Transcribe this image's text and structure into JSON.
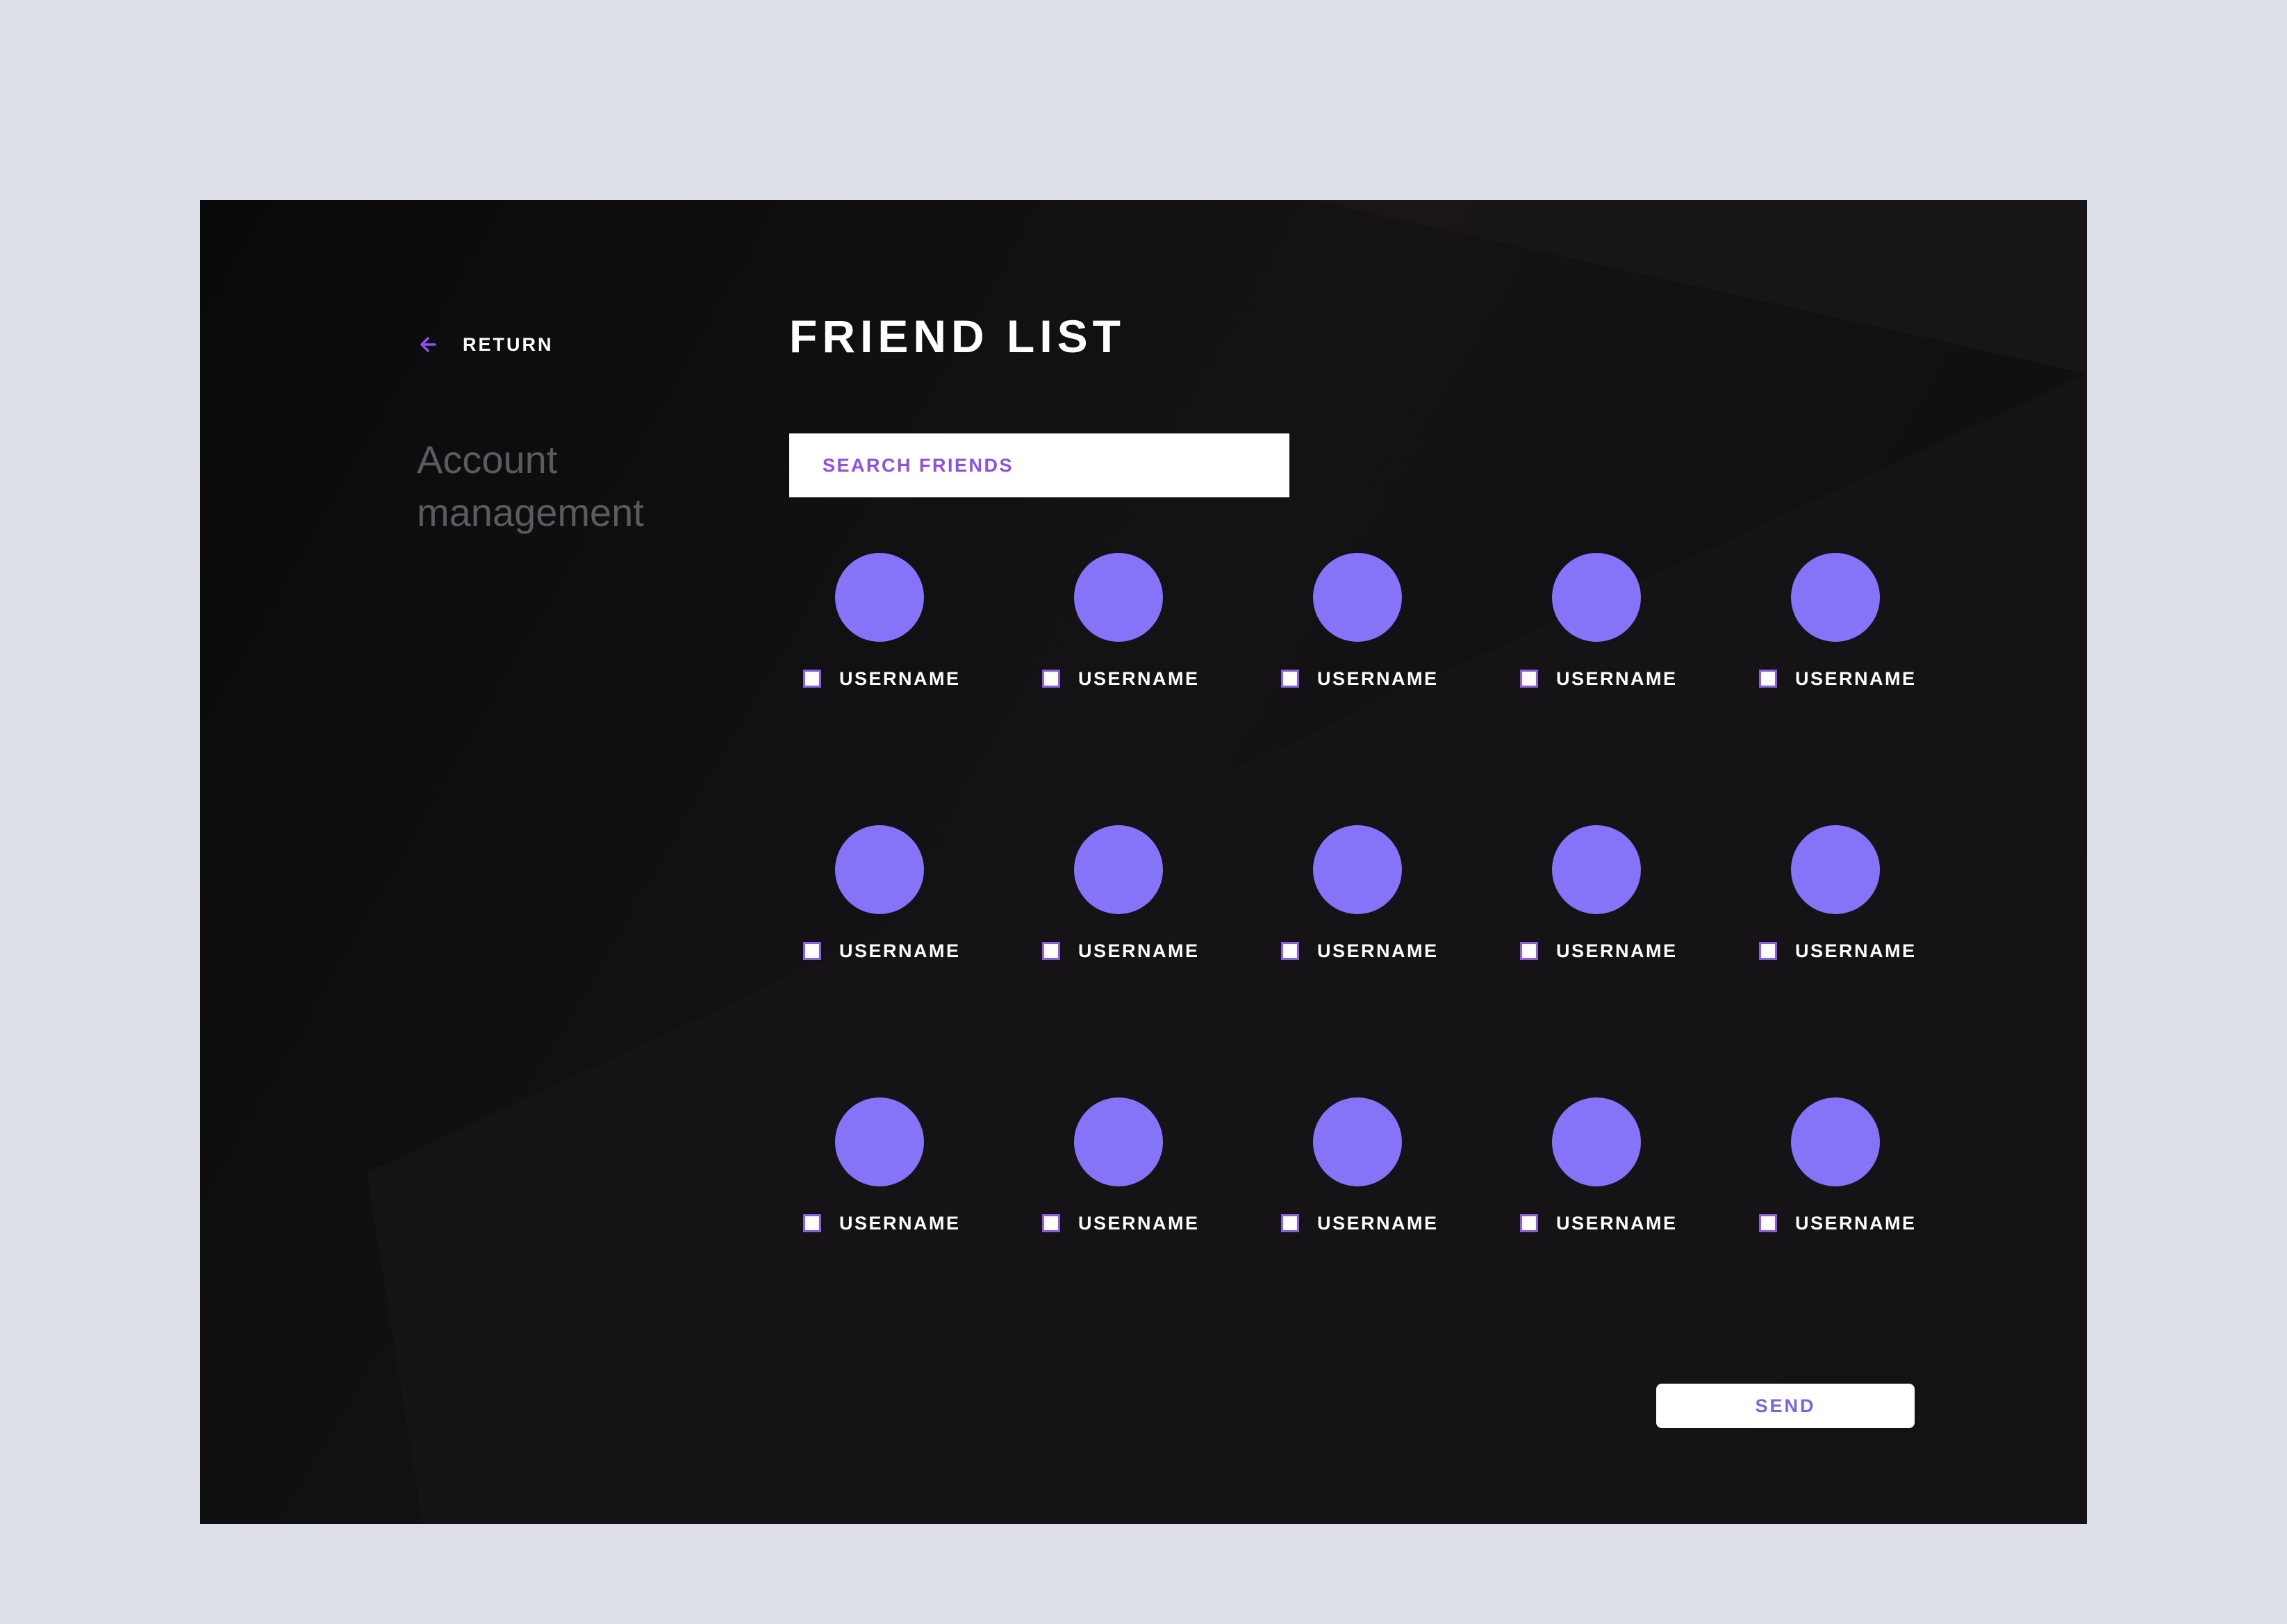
{
  "nav": {
    "return_label": "RETURN",
    "return_icon": "arrow-left-icon"
  },
  "sidebar": {
    "title": "Account management"
  },
  "main": {
    "title": "FRIEND LIST",
    "search_placeholder": "SEARCH FRIENDS",
    "friends": [
      {
        "username": "USERNAME",
        "checked": false
      },
      {
        "username": "USERNAME",
        "checked": false
      },
      {
        "username": "USERNAME",
        "checked": false
      },
      {
        "username": "USERNAME",
        "checked": false
      },
      {
        "username": "USERNAME",
        "checked": false
      },
      {
        "username": "USERNAME",
        "checked": false
      },
      {
        "username": "USERNAME",
        "checked": false
      },
      {
        "username": "USERNAME",
        "checked": false
      },
      {
        "username": "USERNAME",
        "checked": false
      },
      {
        "username": "USERNAME",
        "checked": false
      },
      {
        "username": "USERNAME",
        "checked": false
      },
      {
        "username": "USERNAME",
        "checked": false
      },
      {
        "username": "USERNAME",
        "checked": false
      },
      {
        "username": "USERNAME",
        "checked": false
      },
      {
        "username": "USERNAME",
        "checked": false
      }
    ],
    "send_label": "SEND"
  },
  "colors": {
    "page_background": "#dcdfe8",
    "panel_background": "#0e0d0f",
    "accent_purple": "#8573f8",
    "search_text": "#8f4ef0",
    "send_text": "#7b63e8"
  }
}
